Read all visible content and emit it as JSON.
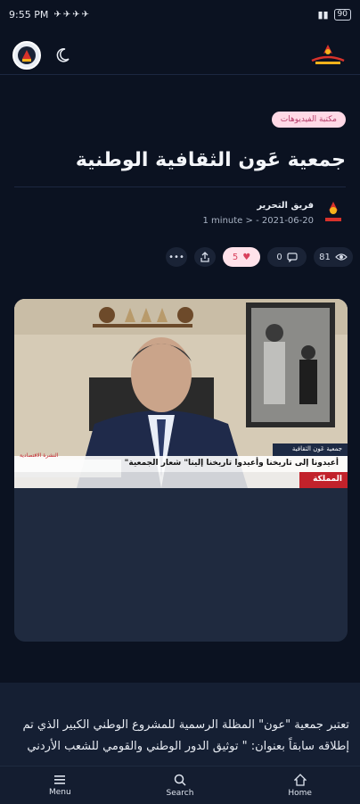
{
  "status": {
    "time": "9:55 PM",
    "battery": "90"
  },
  "article": {
    "category": "مكتبة الفيديوهات",
    "title": "جمعية عَون الثقافية الوطنية",
    "author": "فريق التحرير",
    "date": "2021-06-20",
    "read_time": "1 minute",
    "views": "81",
    "comments": "0",
    "likes": "5",
    "video": {
      "badge": "جمعية عَون الثقافية",
      "caption": "أعيدونا إلى تاريخنا وأعيدوا تاريخنا إلينا\" شعار الجمعية\"",
      "channel": "المملكة",
      "ticker": "النشرة الاقتصادية"
    },
    "body": "تعتبر جمعية \"عون\" المظلة الرسمية للمشروع الوطني الكبير الذي تم إطلاقه سابقاً بعنوان: \" توثيق الدور الوطني والقومي للشعب الأردني"
  },
  "nav": {
    "menu": "Menu",
    "search": "Search",
    "home": "Home"
  },
  "colors": {
    "background": "#0b1221",
    "accent_like": "#d9415d",
    "tag_bg": "#ffd9e6"
  }
}
